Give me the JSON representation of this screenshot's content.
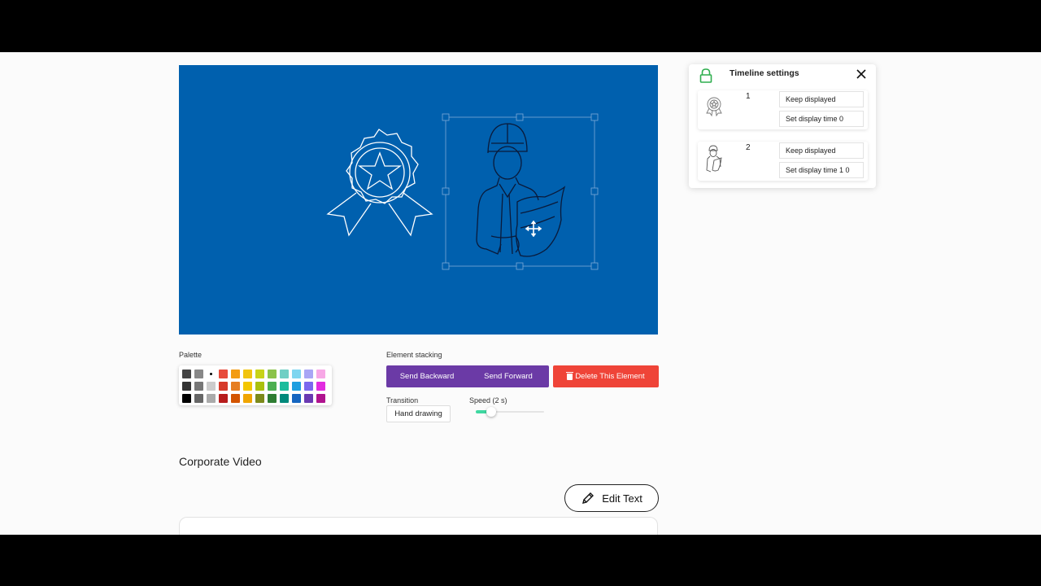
{
  "timeline": {
    "title": "Timeline settings",
    "items": [
      {
        "number": "1",
        "keep_label": "Keep displayed",
        "time_label": "Set display time 0"
      },
      {
        "number": "2",
        "keep_label": "Keep displayed",
        "time_label": "Set display time 1 0"
      }
    ]
  },
  "controls": {
    "palette_label": "Palette",
    "stacking_label": "Element stacking",
    "send_backward": "Send Backward",
    "send_forward": "Send Forward",
    "delete_label": "Delete This Element",
    "transition_label": "Transition",
    "transition_value": "Hand drawing",
    "speed_label": "Speed (2 s)",
    "speed_fraction": 0.2
  },
  "palette_colors": [
    [
      "#444444",
      "#888888",
      "dot",
      "#e74c3c",
      "#f39c12",
      "#f1c40f",
      "#c8d317",
      "#8bc34a",
      "#6fcfc4",
      "#7fd6f0",
      "#a9a6f5",
      "#f7a8e6"
    ],
    [
      "#333333",
      "#777777",
      "#cccccc",
      "#d63a2a",
      "#e67e22",
      "#f3c600",
      "#aac00c",
      "#4caf50",
      "#1abc9c",
      "#1e9fe0",
      "#7b68ee",
      "#e22ce0"
    ],
    [
      "#000000",
      "#666666",
      "#aaaaaa",
      "#b71c1c",
      "#d35400",
      "#f0a500",
      "#7c8a1a",
      "#2e7d32",
      "#00897b",
      "#1565c0",
      "#6a3ab2",
      "#b0148f"
    ]
  ],
  "canvas_color": "#0060ae",
  "section_title": "Corporate Video",
  "edit_text_label": "Edit Text"
}
